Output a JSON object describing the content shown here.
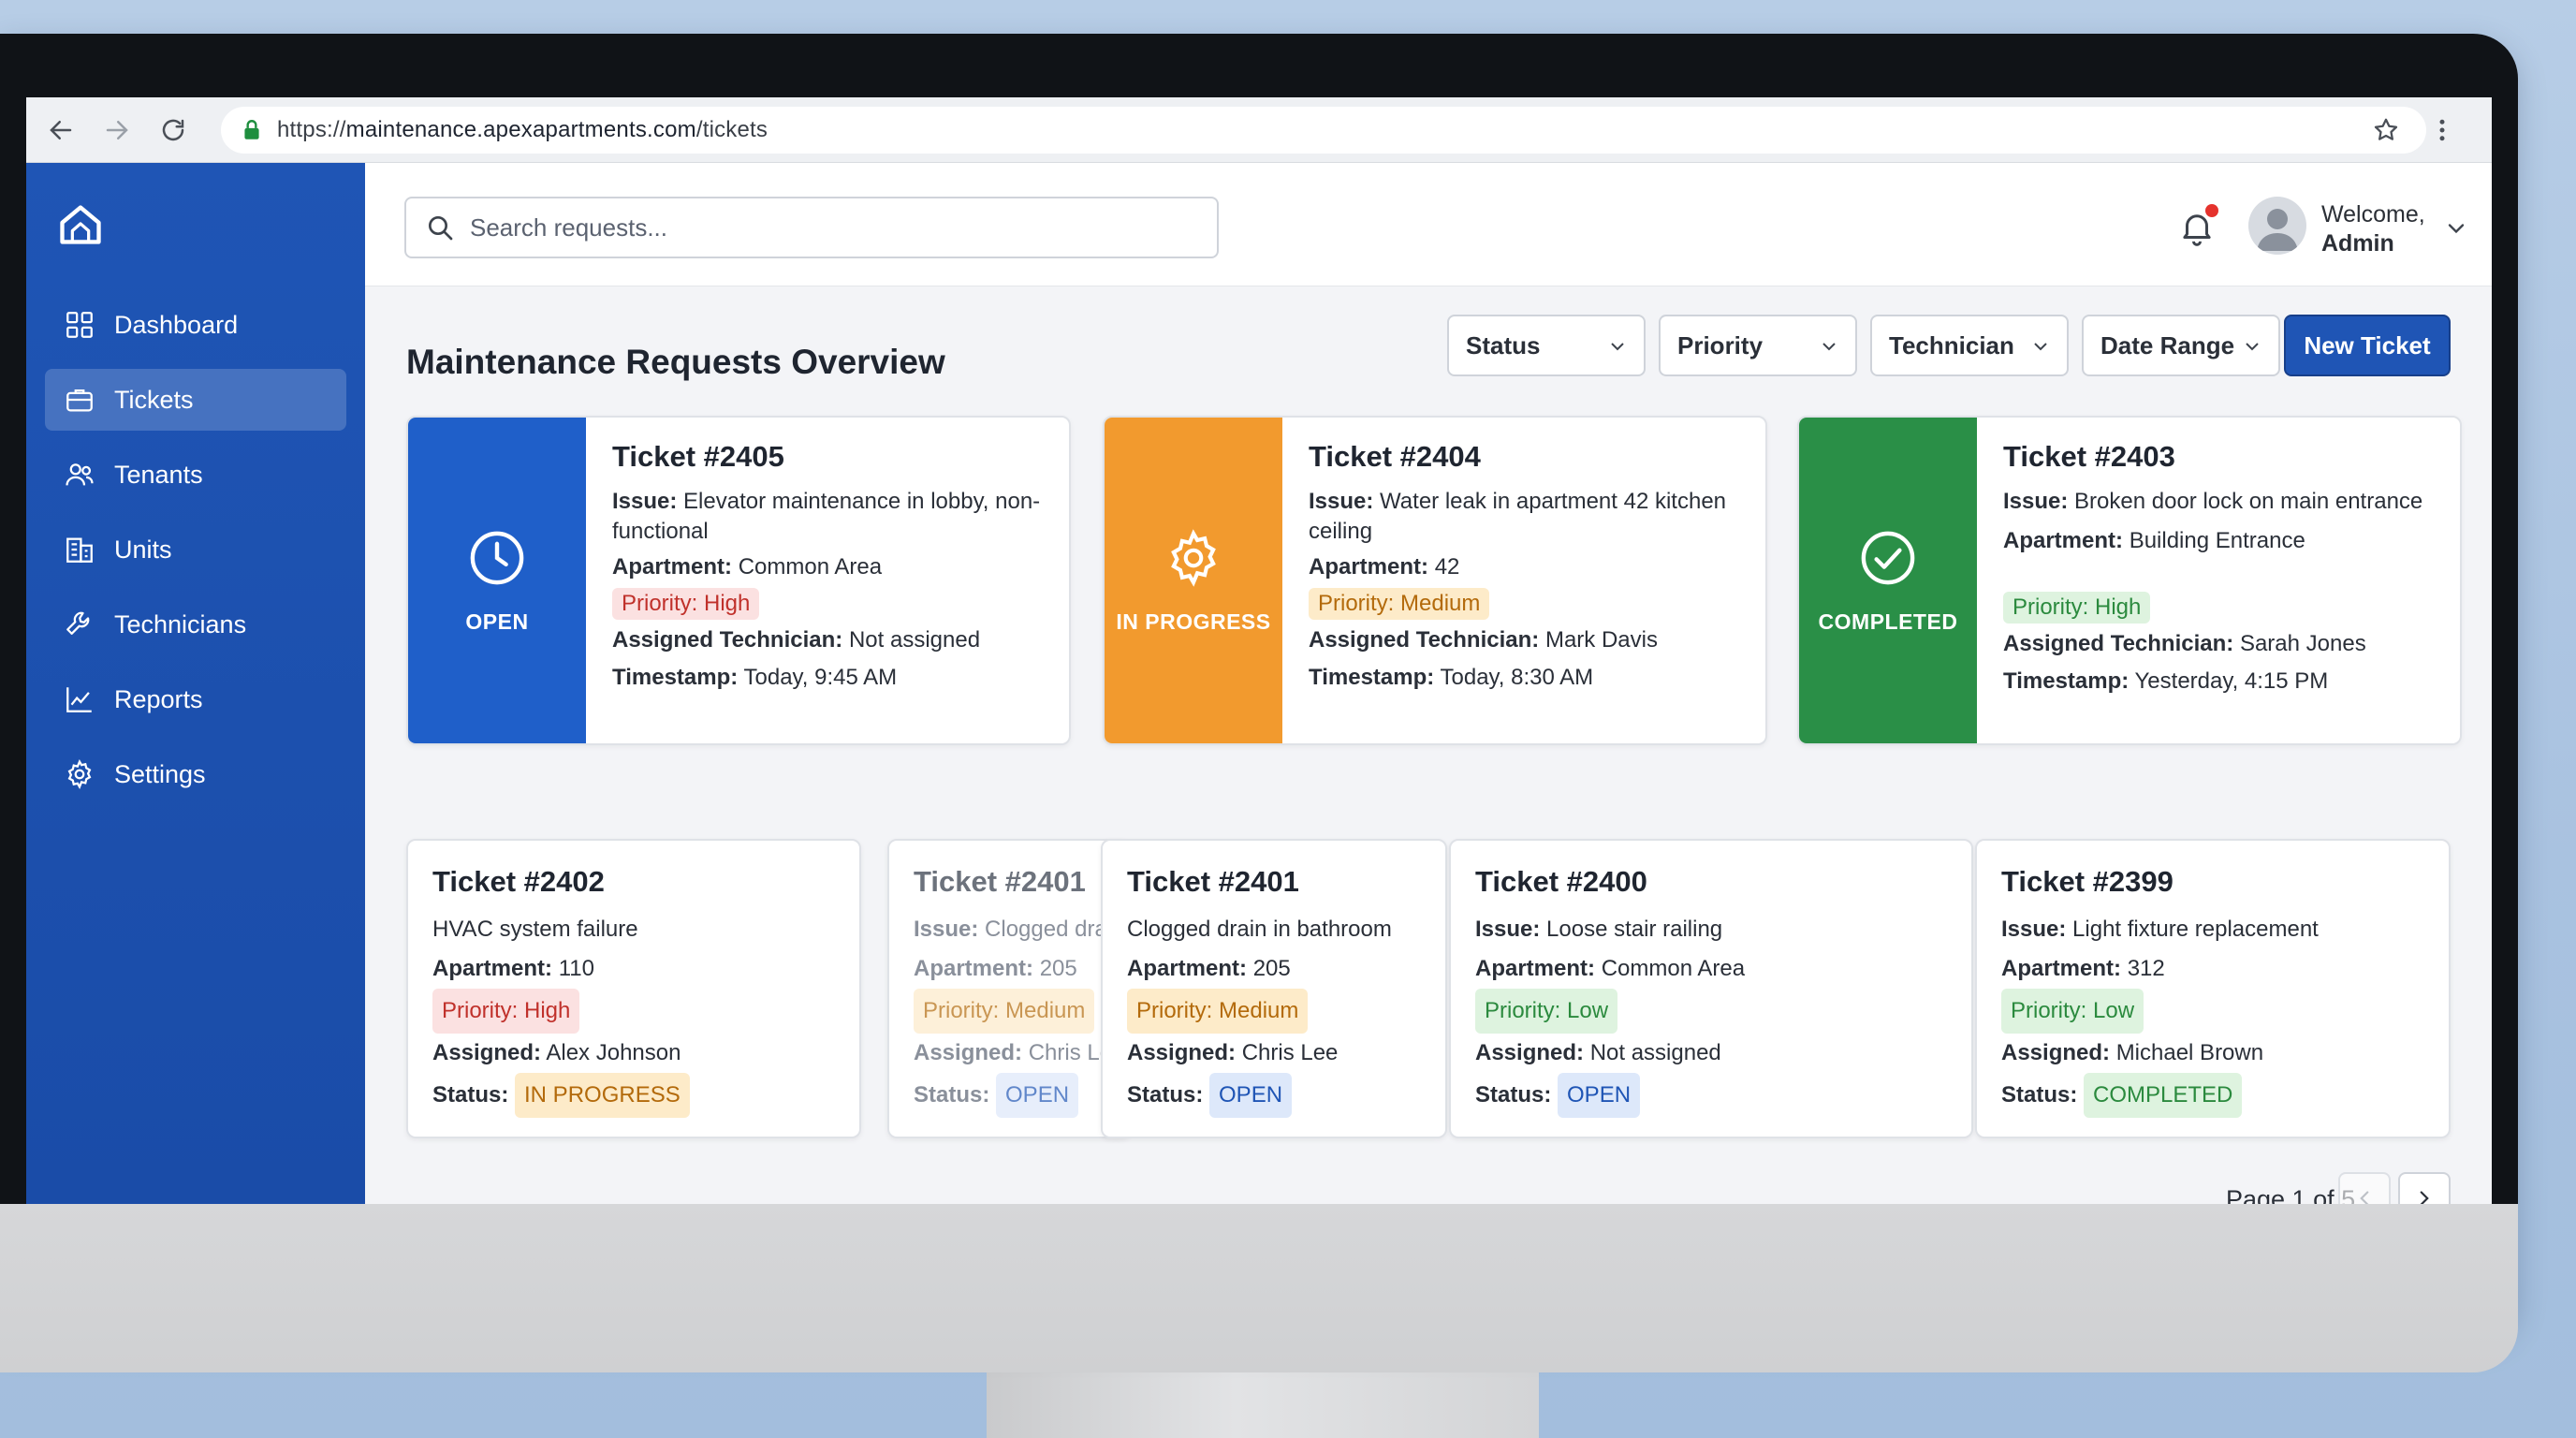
{
  "browser": {
    "url_prefix": "https://",
    "url_domain": "maintenance.apexapartments.com",
    "url_path": "/tickets"
  },
  "sidebar": {
    "items": [
      {
        "label": "Dashboard",
        "icon": "grid-icon"
      },
      {
        "label": "Tickets",
        "icon": "briefcase-icon",
        "active": true
      },
      {
        "label": "Tenants",
        "icon": "people-icon"
      },
      {
        "label": "Units",
        "icon": "building-icon"
      },
      {
        "label": "Technicians",
        "icon": "wrench-icon"
      },
      {
        "label": "Reports",
        "icon": "chart-icon"
      },
      {
        "label": "Settings",
        "icon": "gear-icon"
      }
    ]
  },
  "header": {
    "search_placeholder": "Search requests...",
    "welcome": "Welcome,",
    "user": "Admin"
  },
  "main": {
    "title": "Maintenance Requests Overview",
    "filters": [
      "Status",
      "Priority",
      "Technician",
      "Date Range"
    ],
    "new_ticket": "New Ticket"
  },
  "labels": {
    "issue": "Issue:",
    "apartment": "Apartment:",
    "assigned_technician": "Assigned Technician:",
    "timestamp": "Timestamp:",
    "assigned": "Assigned:",
    "status": "Status:"
  },
  "featured": [
    {
      "title": "Ticket #2405",
      "status": "OPEN",
      "status_color": "#1f5fc9",
      "issue": "Elevator maintenance in lobby, non-functional",
      "apartment": "Common Area",
      "priority": "Priority: High",
      "technician": "Not assigned",
      "timestamp": "Today, 9:45 AM"
    },
    {
      "title": "Ticket #2404",
      "status": "IN PROGRESS",
      "status_color": "#f29a2e",
      "issue": "Water leak in apartment 42 kitchen ceiling",
      "apartment": "42",
      "priority": "Priority: Medium",
      "technician": "Mark Davis",
      "timestamp": "Today, 8:30 AM"
    },
    {
      "title": "Ticket #2403",
      "status": "COMPLETED",
      "status_color": "#2a8f47",
      "issue": "Broken door lock on main entrance",
      "apartment": "Building Entrance",
      "priority": "Priority: High",
      "technician": "Sarah Jones",
      "timestamp": "Yesterday, 4:15 PM"
    }
  ],
  "tickets": [
    {
      "title": "Ticket #2402",
      "issue": "HVAC system failure",
      "apartment": "110",
      "priority": "Priority: High",
      "assigned": "Alex Johnson",
      "status": "IN PROGRESS"
    },
    {
      "title": "Ticket #2401",
      "issue": "Clogged dra",
      "apartment": "205",
      "priority": "Priority: Medium",
      "assigned": "Chris Le",
      "status": "OPEN"
    },
    {
      "title": "Ticket #2401",
      "issue": "Clogged drain in bathroom",
      "apartment": "205",
      "priority": "Priority: Medium",
      "assigned": "Chris Lee",
      "status": "OPEN"
    },
    {
      "title": "Ticket #2400",
      "issue": "Loose stair railing",
      "apartment": "Common Area",
      "priority": "Priority: Low",
      "assigned": "Not assigned",
      "status": "OPEN"
    },
    {
      "title": "Ticket #2399",
      "issue": "Light fixture replacement",
      "apartment": "312",
      "priority": "Priority: Low",
      "assigned": "Michael Brown",
      "status": "COMPLETED"
    }
  ],
  "pagination": {
    "text": "Page 1 of 5"
  }
}
